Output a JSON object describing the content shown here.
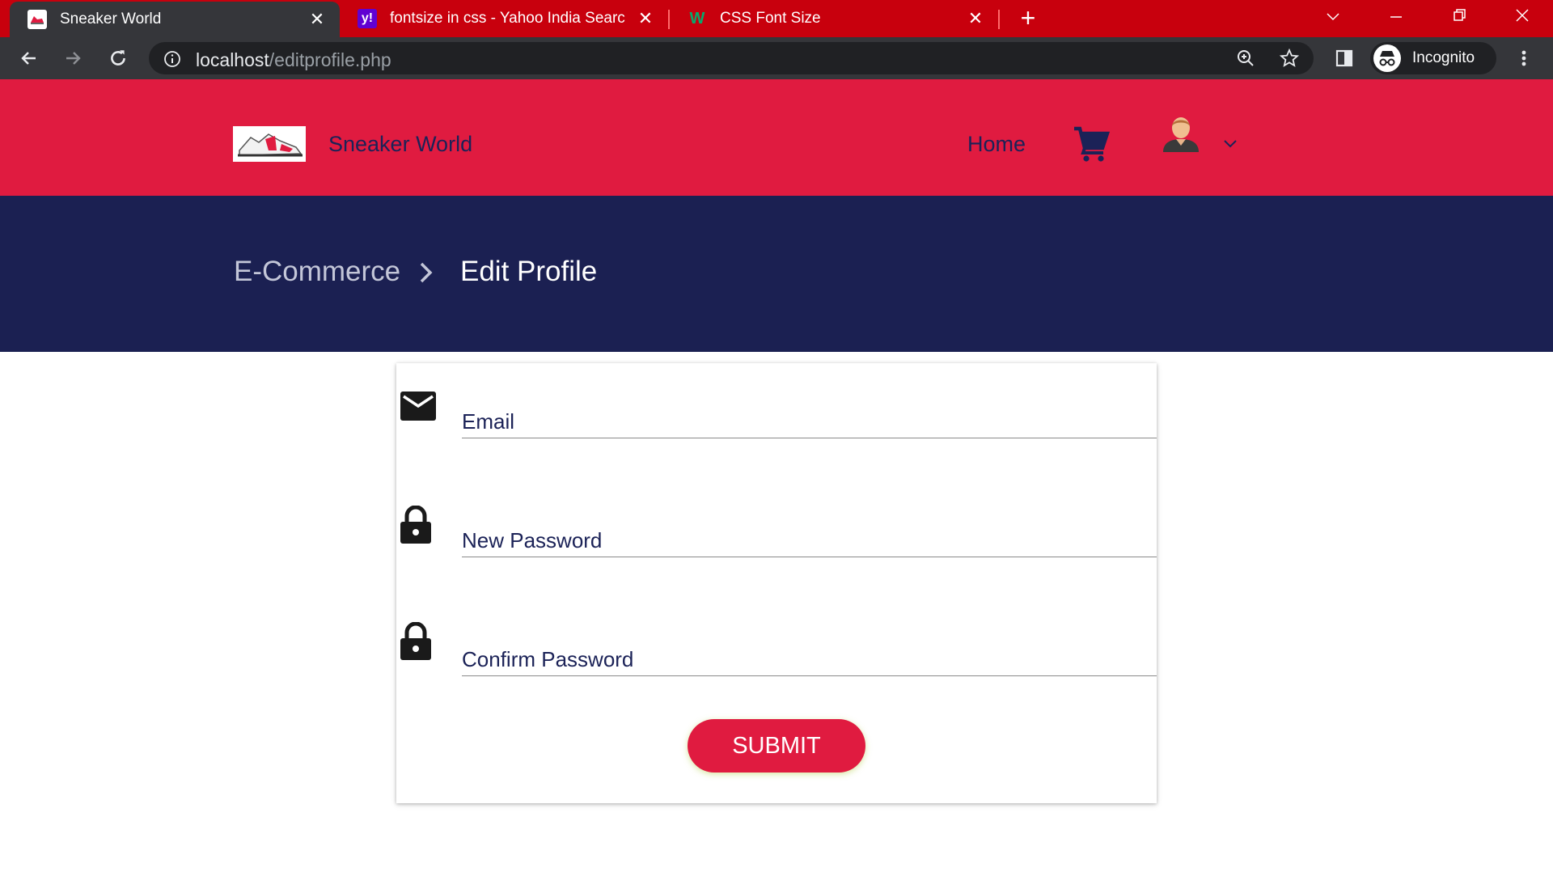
{
  "browser": {
    "tabs": [
      {
        "title": "Sneaker World",
        "favicon": "sneaker-favicon"
      },
      {
        "title": "fontsize in css - Yahoo India Searc",
        "favicon": "yahoo-favicon"
      },
      {
        "title": "CSS Font Size",
        "favicon": "w3schools-favicon"
      }
    ],
    "url_host": "localhost",
    "url_path": "/editprofile.php",
    "profile_label": "Incognito"
  },
  "header": {
    "brand": "Sneaker World",
    "nav_home": "Home",
    "colors": {
      "header_bg": "#e01b40",
      "text": "#1b2257"
    }
  },
  "breadcrumb": {
    "root": "E-Commerce",
    "current": "Edit Profile"
  },
  "form": {
    "email_placeholder": "Email",
    "new_password_placeholder": "New Password",
    "confirm_password_placeholder": "Confirm Password",
    "submit_label": "SUBMIT"
  },
  "colors": {
    "accent": "#e01b40",
    "band": "#1b2052",
    "tabbar": "#c8000d"
  }
}
